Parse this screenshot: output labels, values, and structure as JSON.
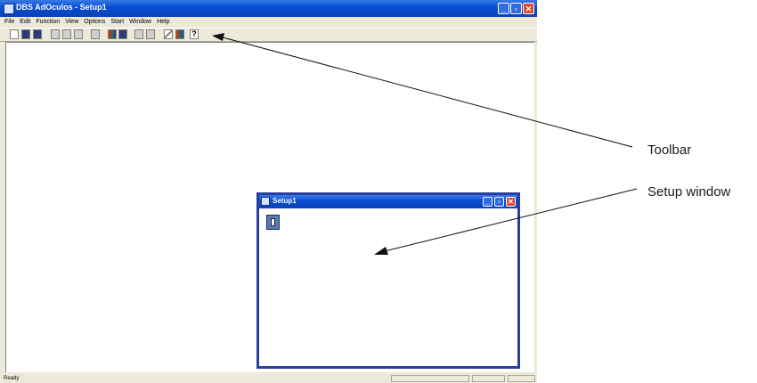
{
  "app": {
    "title": "DBS AdOculos - Setup1",
    "menu": [
      "File",
      "Edit",
      "Function",
      "View",
      "Options",
      "Start",
      "Window",
      "Help"
    ],
    "toolbar_icons": [
      "new-file-icon",
      "open-folder-icon",
      "save-icon",
      "cut-icon",
      "copy-icon",
      "paste-icon",
      "undo-icon",
      "image-icon",
      "image-alt-icon",
      "step-icon",
      "run-icon",
      "line-icon",
      "color-icon",
      "help-icon"
    ],
    "status_text": "Ready"
  },
  "child_window": {
    "title": "Setup1",
    "icon": "trash-icon"
  },
  "annotations": {
    "toolbar": "Toolbar",
    "setup_window": "Setup window"
  }
}
